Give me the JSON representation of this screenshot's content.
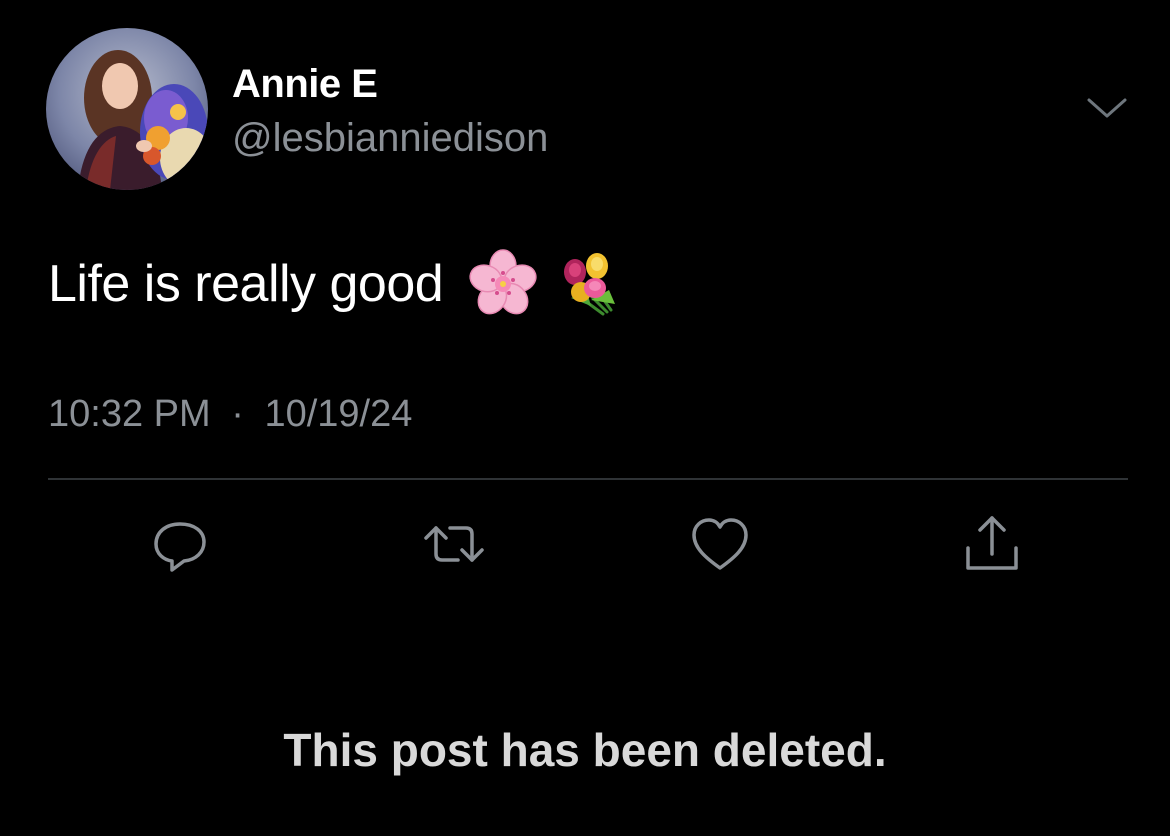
{
  "tweet": {
    "author": {
      "display_name": "Annie E",
      "handle": "@lesbianniedison",
      "avatar_icon": "profile-photo-avatar"
    },
    "more_icon": "chevron-down-icon",
    "text": "Life is really good",
    "emojis": [
      "cherry-blossom-emoji",
      "bouquet-emoji"
    ],
    "time": "10:32 PM",
    "separator": "·",
    "date": "10/19/24",
    "actions": [
      {
        "name": "reply",
        "icon": "reply-icon"
      },
      {
        "name": "retweet",
        "icon": "retweet-icon"
      },
      {
        "name": "like",
        "icon": "heart-icon"
      },
      {
        "name": "share",
        "icon": "share-icon"
      }
    ]
  },
  "notice": {
    "deleted_text": "This post has been deleted."
  },
  "colors": {
    "background": "#000000",
    "primary_text": "#ffffff",
    "secondary_text": "#8b9096",
    "divider": "#2f3336",
    "notice_text": "#d9d9d9"
  }
}
